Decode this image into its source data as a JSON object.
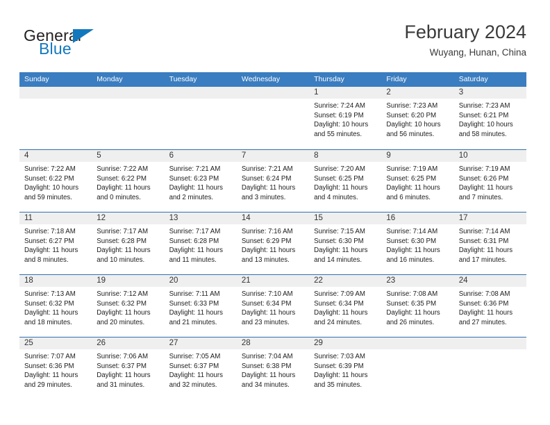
{
  "logo": {
    "word_dark": "General",
    "word_blue": "Blue",
    "triangle_icon": "triangle-icon",
    "accent_color": "#1278be"
  },
  "header": {
    "title": "February 2024",
    "subtitle": "Wuyang, Hunan, China"
  },
  "theme": {
    "header_bar": "#3a7dc0",
    "row_divider": "#2f6fb0",
    "day_strip": "#efefef",
    "text": "#1c1c1c"
  },
  "weekdays": [
    "Sunday",
    "Monday",
    "Tuesday",
    "Wednesday",
    "Thursday",
    "Friday",
    "Saturday"
  ],
  "weeks": [
    [
      {
        "date": "",
        "lines": []
      },
      {
        "date": "",
        "lines": []
      },
      {
        "date": "",
        "lines": []
      },
      {
        "date": "",
        "lines": []
      },
      {
        "date": "1",
        "lines": [
          "Sunrise: 7:24 AM",
          "Sunset: 6:19 PM",
          "Daylight: 10 hours",
          "and 55 minutes."
        ]
      },
      {
        "date": "2",
        "lines": [
          "Sunrise: 7:23 AM",
          "Sunset: 6:20 PM",
          "Daylight: 10 hours",
          "and 56 minutes."
        ]
      },
      {
        "date": "3",
        "lines": [
          "Sunrise: 7:23 AM",
          "Sunset: 6:21 PM",
          "Daylight: 10 hours",
          "and 58 minutes."
        ]
      }
    ],
    [
      {
        "date": "4",
        "lines": [
          "Sunrise: 7:22 AM",
          "Sunset: 6:22 PM",
          "Daylight: 10 hours",
          "and 59 minutes."
        ]
      },
      {
        "date": "5",
        "lines": [
          "Sunrise: 7:22 AM",
          "Sunset: 6:22 PM",
          "Daylight: 11 hours",
          "and 0 minutes."
        ]
      },
      {
        "date": "6",
        "lines": [
          "Sunrise: 7:21 AM",
          "Sunset: 6:23 PM",
          "Daylight: 11 hours",
          "and 2 minutes."
        ]
      },
      {
        "date": "7",
        "lines": [
          "Sunrise: 7:21 AM",
          "Sunset: 6:24 PM",
          "Daylight: 11 hours",
          "and 3 minutes."
        ]
      },
      {
        "date": "8",
        "lines": [
          "Sunrise: 7:20 AM",
          "Sunset: 6:25 PM",
          "Daylight: 11 hours",
          "and 4 minutes."
        ]
      },
      {
        "date": "9",
        "lines": [
          "Sunrise: 7:19 AM",
          "Sunset: 6:25 PM",
          "Daylight: 11 hours",
          "and 6 minutes."
        ]
      },
      {
        "date": "10",
        "lines": [
          "Sunrise: 7:19 AM",
          "Sunset: 6:26 PM",
          "Daylight: 11 hours",
          "and 7 minutes."
        ]
      }
    ],
    [
      {
        "date": "11",
        "lines": [
          "Sunrise: 7:18 AM",
          "Sunset: 6:27 PM",
          "Daylight: 11 hours",
          "and 8 minutes."
        ]
      },
      {
        "date": "12",
        "lines": [
          "Sunrise: 7:17 AM",
          "Sunset: 6:28 PM",
          "Daylight: 11 hours",
          "and 10 minutes."
        ]
      },
      {
        "date": "13",
        "lines": [
          "Sunrise: 7:17 AM",
          "Sunset: 6:28 PM",
          "Daylight: 11 hours",
          "and 11 minutes."
        ]
      },
      {
        "date": "14",
        "lines": [
          "Sunrise: 7:16 AM",
          "Sunset: 6:29 PM",
          "Daylight: 11 hours",
          "and 13 minutes."
        ]
      },
      {
        "date": "15",
        "lines": [
          "Sunrise: 7:15 AM",
          "Sunset: 6:30 PM",
          "Daylight: 11 hours",
          "and 14 minutes."
        ]
      },
      {
        "date": "16",
        "lines": [
          "Sunrise: 7:14 AM",
          "Sunset: 6:30 PM",
          "Daylight: 11 hours",
          "and 16 minutes."
        ]
      },
      {
        "date": "17",
        "lines": [
          "Sunrise: 7:14 AM",
          "Sunset: 6:31 PM",
          "Daylight: 11 hours",
          "and 17 minutes."
        ]
      }
    ],
    [
      {
        "date": "18",
        "lines": [
          "Sunrise: 7:13 AM",
          "Sunset: 6:32 PM",
          "Daylight: 11 hours",
          "and 18 minutes."
        ]
      },
      {
        "date": "19",
        "lines": [
          "Sunrise: 7:12 AM",
          "Sunset: 6:32 PM",
          "Daylight: 11 hours",
          "and 20 minutes."
        ]
      },
      {
        "date": "20",
        "lines": [
          "Sunrise: 7:11 AM",
          "Sunset: 6:33 PM",
          "Daylight: 11 hours",
          "and 21 minutes."
        ]
      },
      {
        "date": "21",
        "lines": [
          "Sunrise: 7:10 AM",
          "Sunset: 6:34 PM",
          "Daylight: 11 hours",
          "and 23 minutes."
        ]
      },
      {
        "date": "22",
        "lines": [
          "Sunrise: 7:09 AM",
          "Sunset: 6:34 PM",
          "Daylight: 11 hours",
          "and 24 minutes."
        ]
      },
      {
        "date": "23",
        "lines": [
          "Sunrise: 7:08 AM",
          "Sunset: 6:35 PM",
          "Daylight: 11 hours",
          "and 26 minutes."
        ]
      },
      {
        "date": "24",
        "lines": [
          "Sunrise: 7:08 AM",
          "Sunset: 6:36 PM",
          "Daylight: 11 hours",
          "and 27 minutes."
        ]
      }
    ],
    [
      {
        "date": "25",
        "lines": [
          "Sunrise: 7:07 AM",
          "Sunset: 6:36 PM",
          "Daylight: 11 hours",
          "and 29 minutes."
        ]
      },
      {
        "date": "26",
        "lines": [
          "Sunrise: 7:06 AM",
          "Sunset: 6:37 PM",
          "Daylight: 11 hours",
          "and 31 minutes."
        ]
      },
      {
        "date": "27",
        "lines": [
          "Sunrise: 7:05 AM",
          "Sunset: 6:37 PM",
          "Daylight: 11 hours",
          "and 32 minutes."
        ]
      },
      {
        "date": "28",
        "lines": [
          "Sunrise: 7:04 AM",
          "Sunset: 6:38 PM",
          "Daylight: 11 hours",
          "and 34 minutes."
        ]
      },
      {
        "date": "29",
        "lines": [
          "Sunrise: 7:03 AM",
          "Sunset: 6:39 PM",
          "Daylight: 11 hours",
          "and 35 minutes."
        ]
      },
      {
        "date": "",
        "lines": []
      },
      {
        "date": "",
        "lines": []
      }
    ]
  ]
}
